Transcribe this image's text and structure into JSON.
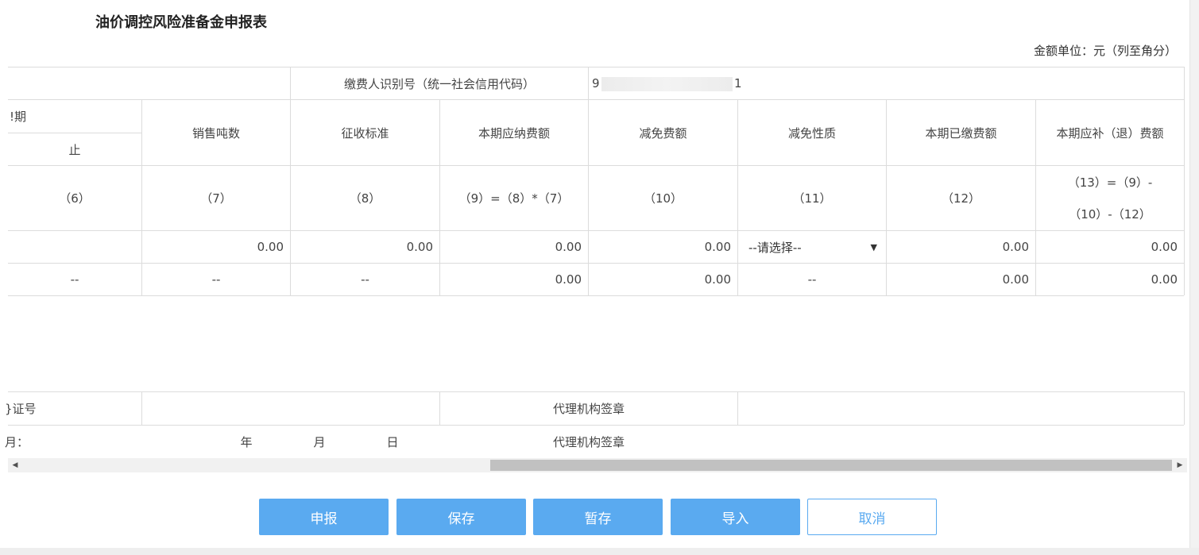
{
  "title": "油价调控风险准备金申报表",
  "unit_label": "金额单位：元（列至角分）",
  "taxpayer": {
    "label": "缴费人识别号（统一社会信用代码）",
    "value_prefix": "9",
    "value_suffix": "1"
  },
  "header": {
    "period_partial": "!期",
    "period_end": "止",
    "columns": [
      "销售吨数",
      "征收标准",
      "本期应纳费额",
      "减免费额",
      "减免性质",
      "本期已缴费额",
      "本期应补（退）费额"
    ]
  },
  "formula_row": {
    "col6": "（6）",
    "col7": "（7）",
    "col8": "（8）",
    "col9": "（9）=（8）*（7）",
    "col10": "（10）",
    "col11": "（11）",
    "col12": "（12）",
    "col13_line1": "（13）=（9）-",
    "col13_line2": "（10）-（12）"
  },
  "data_row": {
    "sales_tons": "0.00",
    "standard": "0.00",
    "payable": "0.00",
    "reduction": "0.00",
    "reduction_nature_placeholder": "--请选择--",
    "paid": "0.00",
    "refund": "0.00"
  },
  "total_row": {
    "col6": "--",
    "col7": "--",
    "col8": "--",
    "payable": "0.00",
    "reduction": "0.00",
    "col11": "--",
    "paid": "0.00",
    "refund": "0.00"
  },
  "footer": {
    "id_label_partial": "}证号",
    "agent_seal": "代理机构签章",
    "date_label_partial": "月：",
    "year": "年",
    "month": "月",
    "day": "日",
    "agent_seal_2": "代理机构签章"
  },
  "buttons": {
    "submit": "申报",
    "save": "保存",
    "temp_save": "暂存",
    "import": "导入",
    "cancel": "取消"
  },
  "colors": {
    "primary": "#5aaaf0",
    "border": "#dcdcdc"
  }
}
